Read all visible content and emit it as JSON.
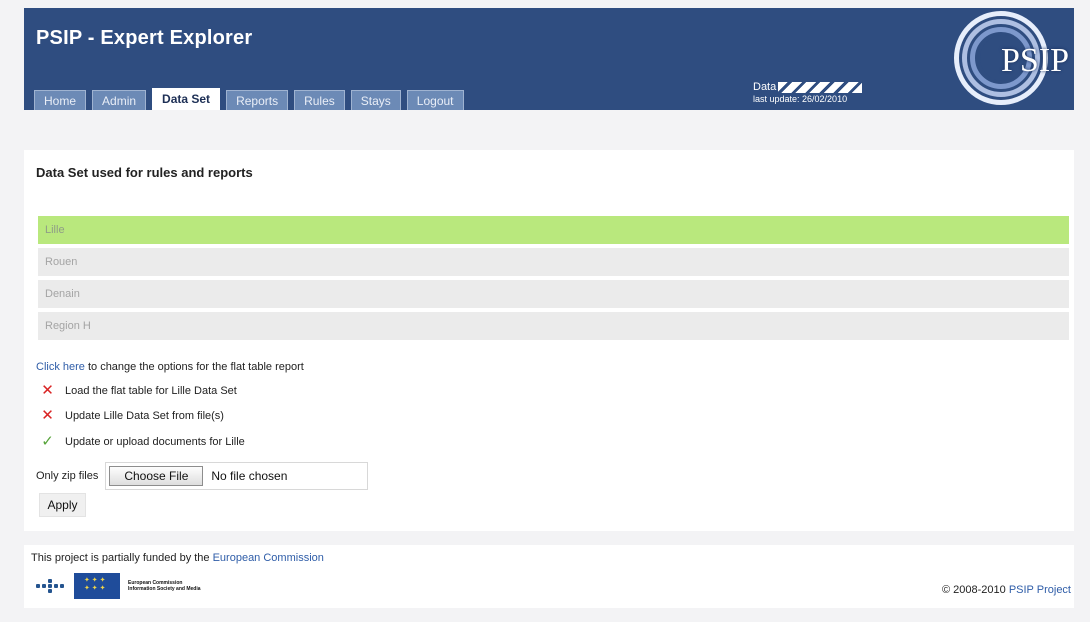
{
  "header": {
    "title": "PSIP - Expert Explorer",
    "tabs": [
      {
        "label": "Home"
      },
      {
        "label": "Admin"
      },
      {
        "label": "Data Set"
      },
      {
        "label": "Reports"
      },
      {
        "label": "Rules"
      },
      {
        "label": "Stays"
      },
      {
        "label": "Logout"
      }
    ],
    "active_tab": "Data Set",
    "data_label": "Data",
    "last_update": "last update: 26/02/2010",
    "logo_text": "PSIP"
  },
  "main": {
    "section_title": "Data Set used for rules and reports",
    "datasets": [
      "Lille",
      "Rouen",
      "Denain",
      "Region H"
    ],
    "selected_dataset": "Lille",
    "options_link": "Click here",
    "options_text": " to change the options for the flat table report",
    "statuses": [
      {
        "icon": "x-icon",
        "label": "Load the flat table for Lille Data Set"
      },
      {
        "icon": "x-icon",
        "label": "Update Lille Data Set from file(s)"
      },
      {
        "icon": "check-icon",
        "label": "Update or upload documents for Lille"
      }
    ],
    "upload": {
      "label": "Only zip files",
      "choose_button": "Choose File",
      "file_status": "No file chosen"
    },
    "apply_button": "Apply"
  },
  "footer": {
    "funding_text": "This project is partially funded by the ",
    "funding_link": "European Commission",
    "eu_logo_text": "European Commission\nInformation Society and Media",
    "copyright_text": "© 2008-2010 ",
    "copyright_link": "PSIP Project"
  },
  "colors": {
    "header_blue": "#2f4d80",
    "tab_blue": "#6c8ab6",
    "selected_green": "#b9e87d",
    "link_blue": "#2f5da8",
    "error_red": "#d92323",
    "success_green": "#56a43a"
  }
}
